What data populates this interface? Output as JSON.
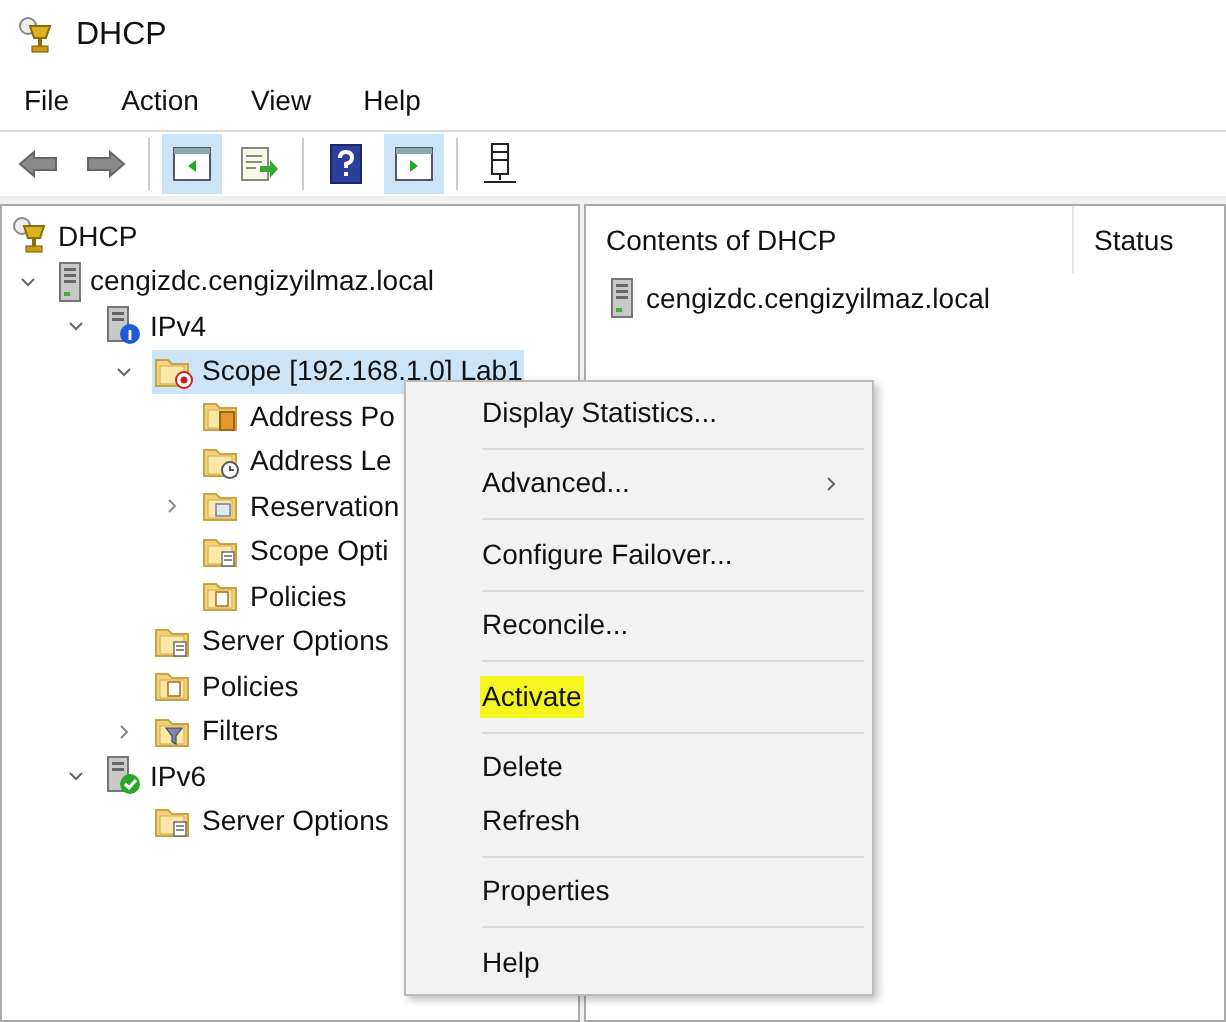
{
  "window": {
    "title": "DHCP"
  },
  "menu_bar": [
    "File",
    "Action",
    "View",
    "Help"
  ],
  "toolbar": [
    {
      "kind": "back",
      "pressed": false
    },
    {
      "kind": "forward",
      "pressed": false
    },
    {
      "kind": "separator"
    },
    {
      "kind": "tree-toggle",
      "pressed": true
    },
    {
      "kind": "export",
      "pressed": false
    },
    {
      "kind": "separator"
    },
    {
      "kind": "help",
      "pressed": false
    },
    {
      "kind": "pane-toggle",
      "pressed": true
    },
    {
      "kind": "separator"
    },
    {
      "kind": "server",
      "pressed": false
    }
  ],
  "tree": [
    {
      "label": "DHCP",
      "kind": "dhcp",
      "selected": false,
      "children": [
        {
          "label": "cengizdc.cengizyilmaz.local",
          "kind": "server",
          "selected": false,
          "expanded": true,
          "children": [
            {
              "label": "IPv4",
              "kind": "ipv4",
              "selected": false,
              "expanded": true,
              "children": [
                {
                  "label": "Scope [192.168.1.0] Lab1",
                  "kind": "scope",
                  "selected": true,
                  "expanded": true,
                  "children": [
                    {
                      "label": "Address Po",
                      "kind": "pool",
                      "selected": false
                    },
                    {
                      "label": "Address Le",
                      "kind": "leases",
                      "selected": false
                    },
                    {
                      "label": "Reservation",
                      "kind": "reservations",
                      "selected": false,
                      "expanded": false
                    },
                    {
                      "label": "Scope Opti",
                      "kind": "options",
                      "selected": false
                    },
                    {
                      "label": "Policies",
                      "kind": "policies",
                      "selected": false
                    }
                  ]
                },
                {
                  "label": "Server Options",
                  "kind": "options",
                  "selected": false
                },
                {
                  "label": "Policies",
                  "kind": "policies",
                  "selected": false
                },
                {
                  "label": "Filters",
                  "kind": "filters",
                  "selected": false,
                  "expanded": false
                }
              ]
            },
            {
              "label": "IPv6",
              "kind": "ipv6",
              "selected": false,
              "expanded": true,
              "children": [
                {
                  "label": "Server Options",
                  "kind": "options",
                  "selected": false
                }
              ]
            }
          ]
        }
      ]
    }
  ],
  "list": {
    "columns": [
      "Contents of DHCP",
      "Status"
    ],
    "rows": [
      {
        "name": "cengizdc.cengizyilmaz.local",
        "kind": "server"
      }
    ]
  },
  "context_menu": [
    {
      "kind": "item",
      "label": "Display Statistics...",
      "highlighted": false
    },
    {
      "kind": "separator"
    },
    {
      "kind": "item",
      "label": "Advanced...",
      "highlighted": false,
      "submenu": true
    },
    {
      "kind": "separator"
    },
    {
      "kind": "item",
      "label": "Configure Failover...",
      "highlighted": false
    },
    {
      "kind": "separator"
    },
    {
      "kind": "item",
      "label": "Reconcile...",
      "highlighted": false
    },
    {
      "kind": "separator"
    },
    {
      "kind": "item",
      "label": "Activate",
      "highlighted": true
    },
    {
      "kind": "separator"
    },
    {
      "kind": "item",
      "label": "Delete",
      "highlighted": false
    },
    {
      "kind": "item",
      "label": "Refresh",
      "highlighted": false
    },
    {
      "kind": "separator"
    },
    {
      "kind": "item",
      "label": "Properties",
      "highlighted": false
    },
    {
      "kind": "separator"
    },
    {
      "kind": "item",
      "label": "Help",
      "highlighted": false
    }
  ]
}
